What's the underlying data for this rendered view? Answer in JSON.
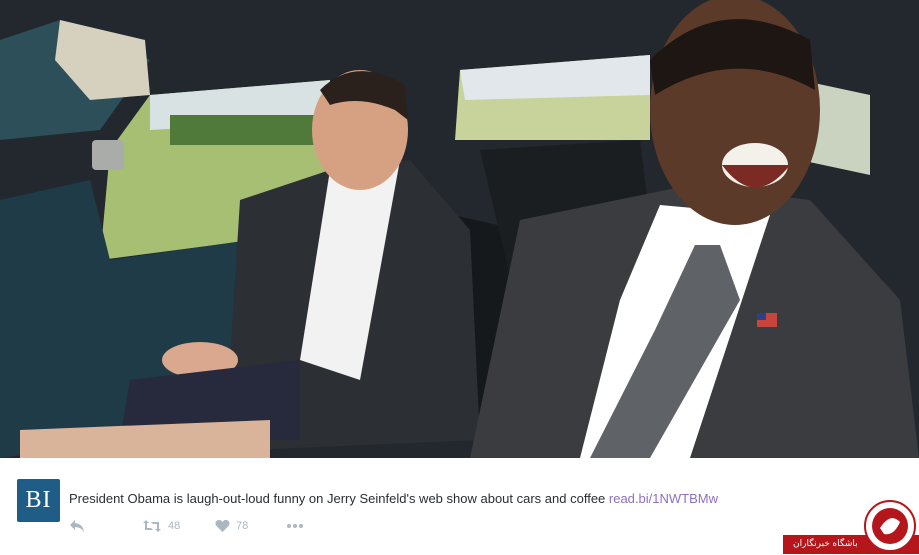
{
  "media": {
    "scene": "car-interior-photo"
  },
  "tweet": {
    "avatar_text": "BI",
    "text": "President Obama is laugh-out-loud funny on Jerry Seinfeld's web show about cars and coffee ",
    "link": "read.bi/1NWTBMw",
    "actions": {
      "reply_icon": "reply-icon",
      "retweet_icon": "retweet-icon",
      "retweet_count": "48",
      "like_icon": "heart-icon",
      "like_count": "78",
      "more_icon": "more-icon"
    }
  },
  "watermark": {
    "text": "باشگاه خبرنگاران"
  },
  "colors": {
    "avatar_bg": "#1f5c86",
    "link": "#8f6fc0",
    "action_grey": "#aab8c2",
    "watermark_red": "#b4161b"
  }
}
